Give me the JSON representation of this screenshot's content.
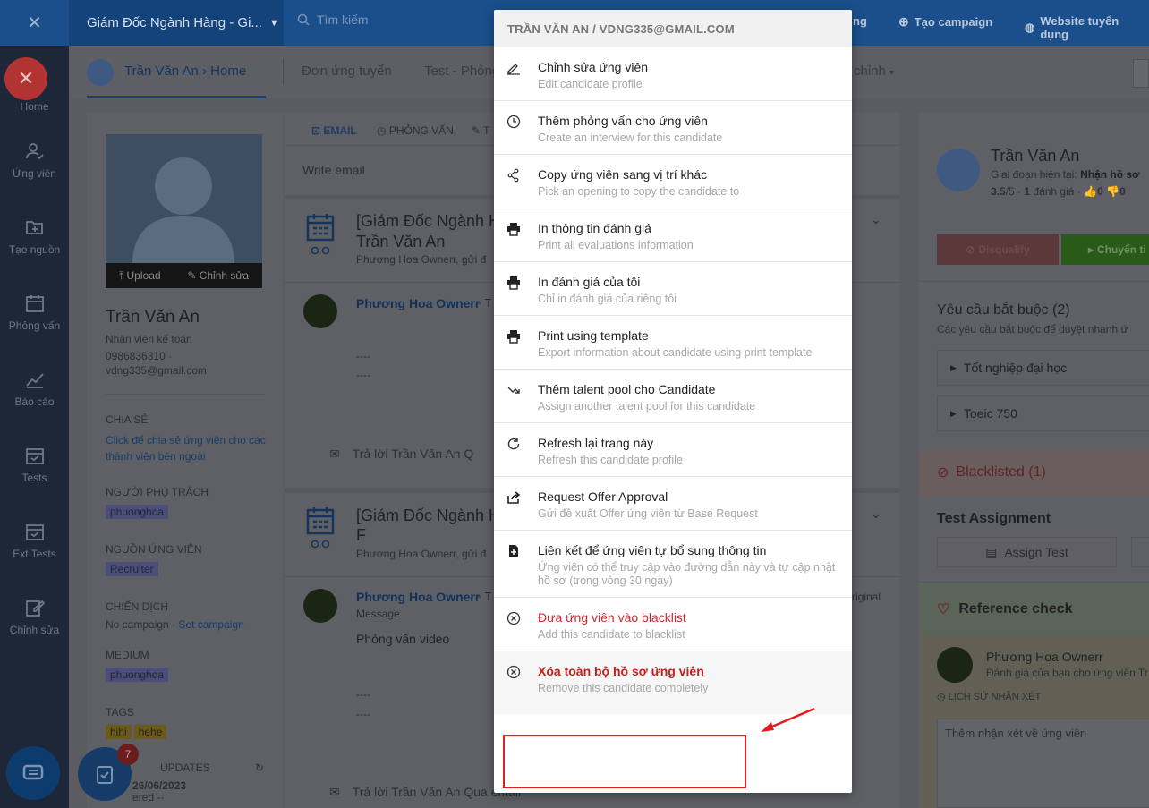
{
  "topbar": {
    "job_title": "Giám Đốc Ngành Hàng - Gi...",
    "search_placeholder": "Tìm kiếm",
    "partial_item": "ng",
    "create_campaign": "Tạo campaign",
    "website": "Website tuyển dụng"
  },
  "leftnav": {
    "items": [
      "Home",
      "Ứng viên",
      "Tạo nguồn",
      "Phỏng vấn",
      "Báo cáo",
      "Tests",
      "Ext Tests",
      "Chỉnh sửa"
    ]
  },
  "header": {
    "breadcrumb": "Trần Văn An › Home",
    "tab_applications": "Đơn ứng tuyển",
    "tab_test": "Test - Phỏng",
    "tab_edit": "chỉnh"
  },
  "profile": {
    "upload": "Upload",
    "edit": "Chỉnh sửa",
    "name": "Trần Văn An",
    "title": "Nhân viên kế toán",
    "phone": "0986836310 ·",
    "email": "vdng335@gmail.com",
    "share_label": "CHIA SẺ",
    "share_link": "Click để chia sẻ ứng viên cho các thành viên bên ngoài",
    "owner_label": "NGƯỜI PHỤ TRÁCH",
    "owner_tag": "phuonghoa",
    "source_label": "NGUỒN ỨNG VIÊN",
    "source_tag": "Recruiter",
    "campaign_label": "CHIẾN DỊCH",
    "campaign_value": "No campaign ·",
    "campaign_link": "Set campaign",
    "medium_label": "MEDIUM",
    "medium_tag": "phuonghoa",
    "tags_label": "TAGS",
    "tags": [
      "hihi",
      "hehe"
    ],
    "updates_label": "UPDATES",
    "updates_date": "26/06/2023",
    "updates_sub": "ered --"
  },
  "feed": {
    "tab_email": "EMAIL",
    "tab_interview": "PHỎNG VẤN",
    "tab_t": "T",
    "write_email": "Write email",
    "card1_title": "[Giám Đốc Ngành H",
    "card1_title2": "Trần Văn An",
    "card1_sub": "Phương Hoa Ownerr, gửi đ",
    "card1_sender": "Phương Hoa Ownerr",
    "card1_dot": "· T",
    "card1_dash1": "----",
    "card1_dash2": "----",
    "card1_reply": "Trả lời Trần Văn An Q",
    "card2_title": "[Giám Đốc Ngành H",
    "card2_title2": "F",
    "card2_sub": "Phương Hoa Ownerr, gửi đ",
    "card2_sender": "Phương Hoa Ownerr",
    "card2_dot": "· T",
    "card2_original": "riginal",
    "card2_msg_label": "Message",
    "card2_msg": "Phỏng vấn video",
    "card2_dash1": "----",
    "card2_dash2": "----",
    "card2_reply": "Trả lời Trần Văn An Qua email"
  },
  "right": {
    "name": "Trần Văn An",
    "stage_label": "Giai đoạn hiện tại:",
    "stage_value": "Nhận hồ sơ",
    "rating": "3.5",
    "rating_max": "/5 ·",
    "rating_count": "1",
    "rating_text": "đánh giá ·",
    "likes": "0",
    "dislikes": "0",
    "disqualify": "Disqualify",
    "move": "Chuyển ti",
    "req_title": "Yêu cầu bắt buộc (2)",
    "req_sub": "Các yêu cầu bắt buộc để duyệt nhanh ứ",
    "req_items": [
      "Tốt nghiệp đại học",
      "Toeic 750"
    ],
    "blacklisted": "Blacklisted (1)",
    "test_title": "Test Assignment",
    "assign_test": "Assign Test",
    "ref_title": "Reference check",
    "reviewer": "Phương Hoa Ownerr",
    "review_sub": "Đánh giá của bạn cho ứng viên Tr",
    "history": "LỊCH SỬ NHẬN XÉT",
    "comment_placeholder": "Thêm nhận xét về ứng viên"
  },
  "badge_count": "7",
  "menu": {
    "header": "TRẦN VĂN AN / VDNG335@GMAIL.COM",
    "items": [
      {
        "title": "Chỉnh sửa ứng viên",
        "sub": "Edit candidate profile"
      },
      {
        "title": "Thêm phỏng vấn cho ứng viên",
        "sub": "Create an interview for this candidate"
      },
      {
        "title": "Copy ứng viên sang vị trí khác",
        "sub": "Pick an opening to copy the candidate to"
      },
      {
        "title": "In thông tin đánh giá",
        "sub": "Print all evaluations information"
      },
      {
        "title": "In đánh giá của tôi",
        "sub": "Chỉ in đánh giá của riêng tôi"
      },
      {
        "title": "Print using template",
        "sub": "Export information about candidate using print template"
      },
      {
        "title": "Thêm talent pool cho Candidate",
        "sub": "Assign another talent pool for this candidate"
      },
      {
        "title": "Refresh lại trang này",
        "sub": "Refresh this candidate profile"
      },
      {
        "title": "Request Offer Approval",
        "sub": "Gửi đề xuất Offer ứng viên từ Base Request"
      },
      {
        "title": "Liên kết để ứng viên tự bổ sung thông tin",
        "sub": "Ứng viên có thể truy cập vào đường dẫn này và tự cập nhật hồ sơ (trong vòng 30 ngày)"
      },
      {
        "title": "Đưa ứng viên vào blacklist",
        "sub": "Add this candidate to blacklist"
      },
      {
        "title": "Xóa toàn bộ hồ sơ ứng viên",
        "sub": "Remove this candidate completely"
      }
    ]
  },
  "colors": {
    "highlight": "#e02020",
    "danger": "#d0262d",
    "accent": "#1a4f8c"
  }
}
